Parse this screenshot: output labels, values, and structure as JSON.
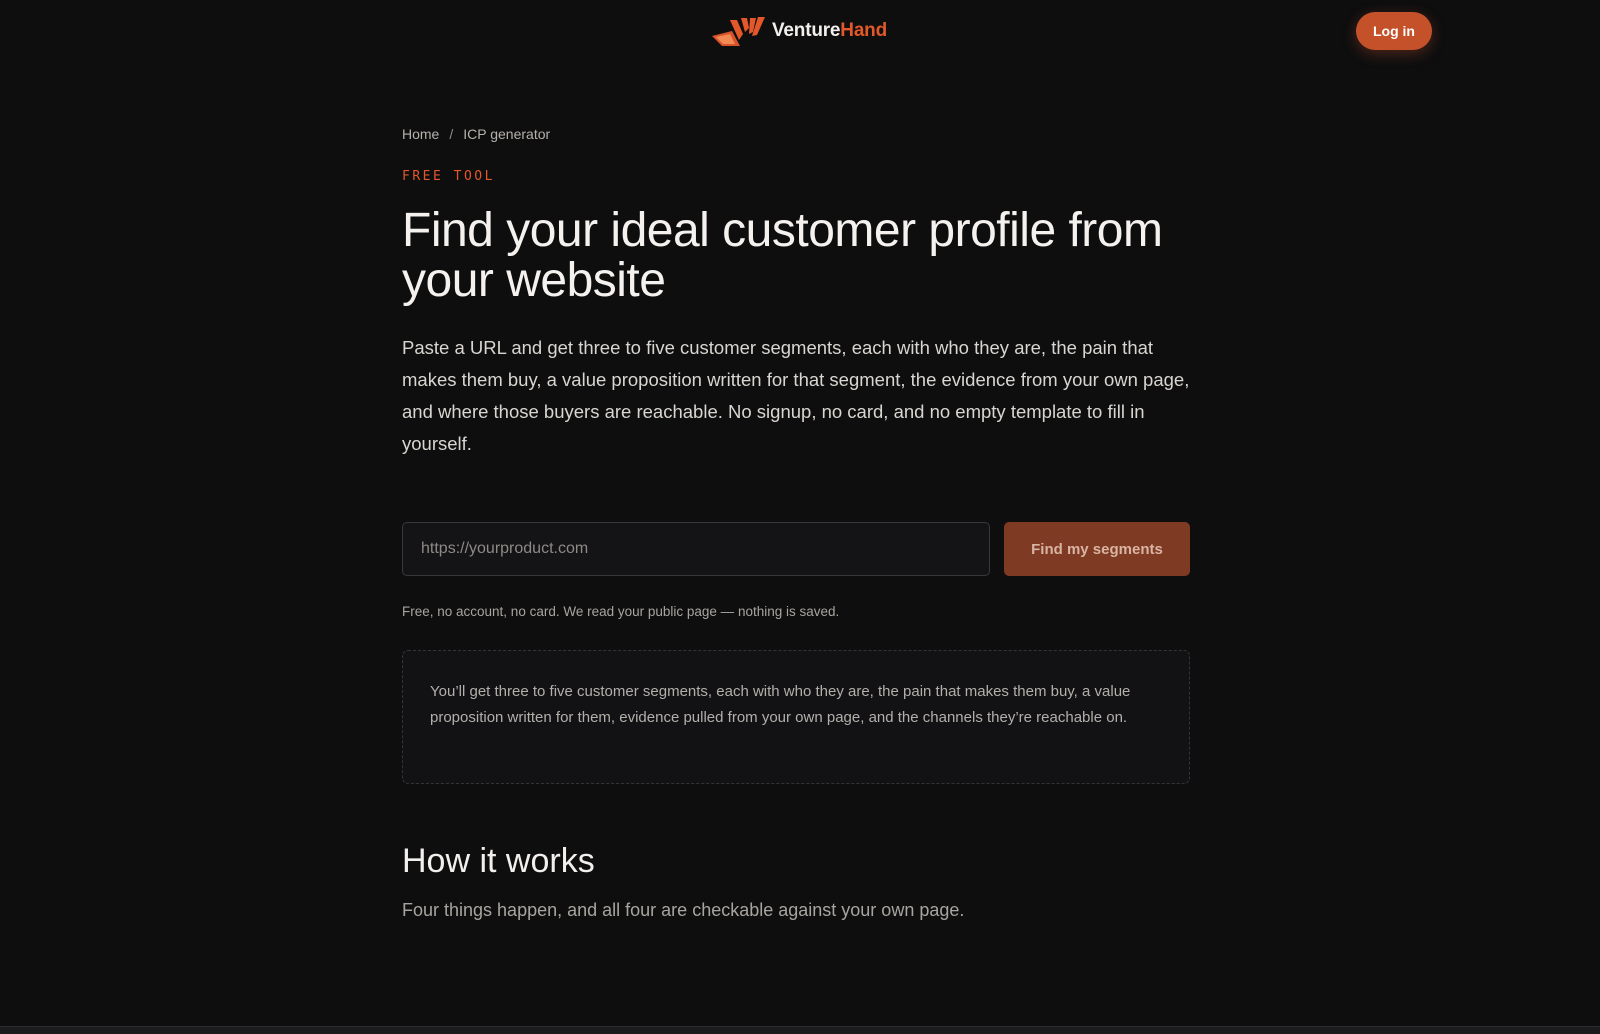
{
  "header": {
    "logo": {
      "icon": "venturehand-logo-icon",
      "word_primary": "Venture",
      "word_accent": "Hand"
    },
    "login_label": "Log in"
  },
  "breadcrumb": {
    "home": "Home",
    "separator": "/",
    "current": "ICP generator"
  },
  "hero": {
    "eyebrow": "FREE TOOL",
    "title": "Find your ideal customer profile from your website",
    "lede": "Paste a URL and get three to five customer segments, each with who they are, the pain that makes them buy, a value proposition written for that segment, the evidence from your own page, and where those buyers are reachable. No signup, no card, and no empty template to fill in yourself."
  },
  "form": {
    "url_placeholder": "https://yourproduct.com",
    "url_value": "",
    "submit_label": "Find my segments",
    "note": "Free, no account, no card. We read your public page — nothing is saved."
  },
  "info_box": {
    "text": "You’ll get three to five customer segments, each with who they are, the pain that makes them buy, a value proposition written for them, evidence pulled from your own page, and the channels they’re reachable on."
  },
  "how_it_works": {
    "title": "How it works",
    "subtitle": "Four things happen, and all four are checkable against your own page."
  },
  "colors": {
    "background": "#0e0e0f",
    "accent": "#e2582b",
    "button": "#c4512a",
    "submit_button": "#7e3a22"
  }
}
